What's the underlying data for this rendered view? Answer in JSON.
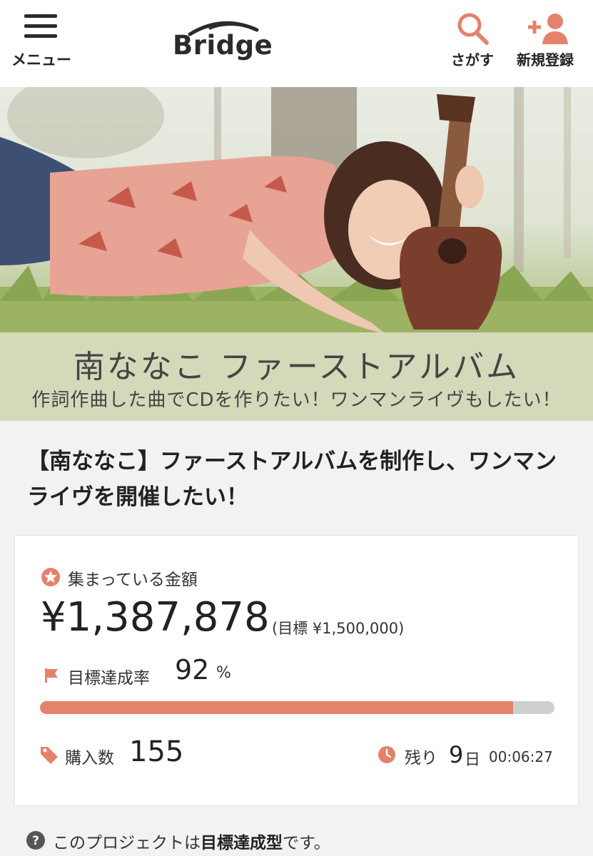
{
  "header": {
    "menu_label": "メニュー",
    "logo_text": "Bridge",
    "search_label": "さがす",
    "register_label": "新規登録"
  },
  "hero": {
    "title": "南ななこ ファーストアルバム",
    "subtitle": "作詞作曲した曲でCDを作りたい！ワンマンライヴもしたい！"
  },
  "project": {
    "title": "【南ななこ】ファーストアルバムを制作し、ワンマンライヴを開催したい！"
  },
  "stats": {
    "collected_label": "集まっている金額",
    "collected_amount": "¥1,387,878",
    "goal_text": "(目標 ¥1,500,000)",
    "rate_label": "目標達成率",
    "rate_value": "92",
    "rate_unit": "%",
    "progress_fraction": 0.92,
    "buyers_label": "購入数",
    "buyers_value": "155",
    "remaining_label": "残り",
    "remaining_days": "9",
    "remaining_days_unit": "日",
    "remaining_time": "00:06:27"
  },
  "note": {
    "prefix": "このプロジェクトは",
    "emphasis": "目標達成型",
    "suffix": "です。"
  },
  "colors": {
    "accent": "#e4826b",
    "progress_track": "#cfcfcf",
    "text_dark": "#222222"
  }
}
